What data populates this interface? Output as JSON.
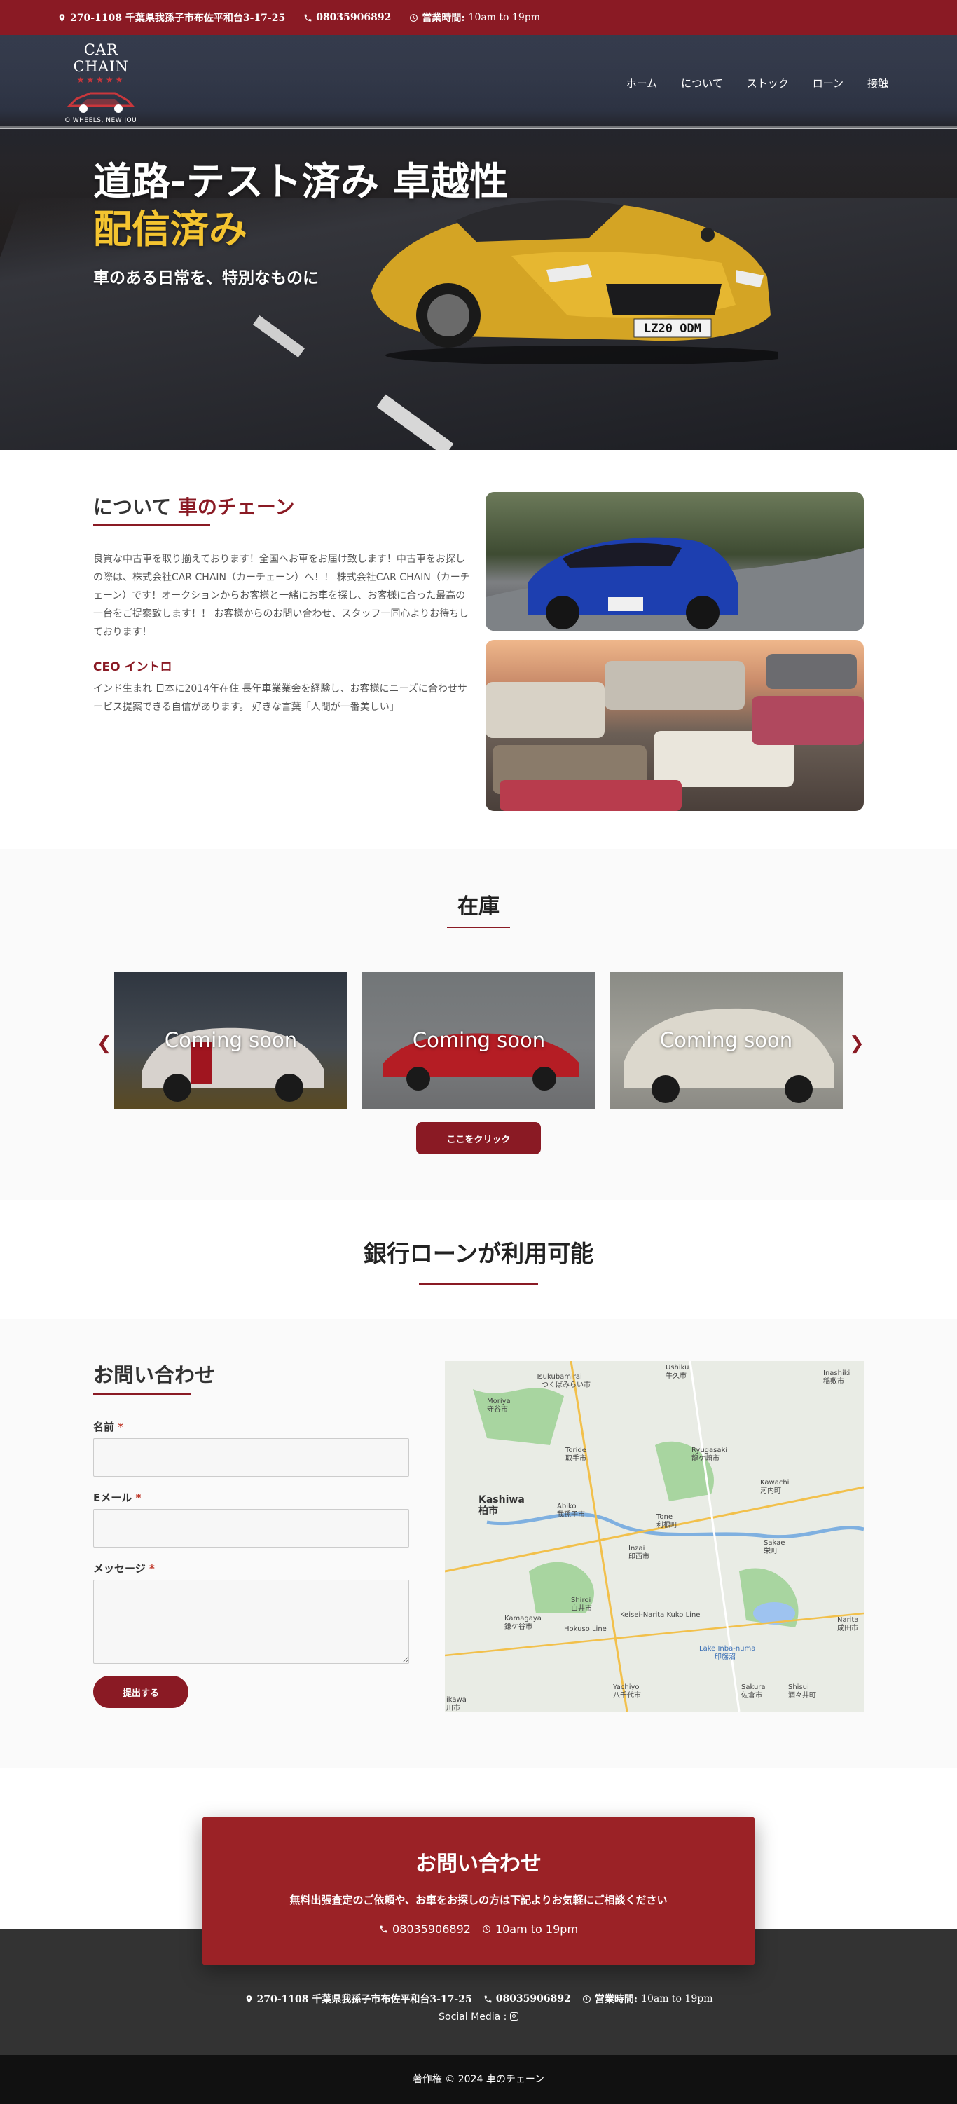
{
  "topbar": {
    "address": "270-1108 千葉県我孫子市布佐平和台3-17-25",
    "phone": "08035906892",
    "hours_label": "営業時間:",
    "hours_value": "10am to 19pm"
  },
  "logo": {
    "title": "CAR CHAIN",
    "stars": "★★★★★",
    "slogan": "O WHEELS, NEW JOU"
  },
  "nav": {
    "items": [
      "ホーム",
      "について",
      "ストック",
      "ローン",
      "接触"
    ]
  },
  "hero": {
    "title_line1": "道路-テスト済み 卓越性",
    "title_line2": "配信済み",
    "subtitle": "車のある日常を、特別なものに",
    "plate": "LZ20 ODM"
  },
  "about": {
    "title_plain": "について",
    "title_accent": "車のチェーン",
    "paragraph": "良質な中古車を取り揃えております！全国へお車をお届け致します！中古車をお探しの際は、株式会社CAR CHAIN（カーチェーン）へ！！ 株式会社CAR CHAIN（カーチェーン）です！オークションからお客様と一緒にお車を探し、お客様に合った最高の一台をご提案致します！！ お客様からのお問い合わせ、スタッフ一同心よりお待ちしております！",
    "ceo_heading": "CEO イントロ",
    "ceo_text": "インド生まれ 日本に2014年在住 長年車業業会を経験し、お客様にニーズに合わせサービス提案できる自信があります。 好きな言葉「人間が一番美しい」"
  },
  "stock": {
    "title": "在庫",
    "cards": [
      "Coming soon",
      "Coming soon",
      "Coming soon"
    ],
    "button": "ここをクリック"
  },
  "loan": {
    "title": "銀行ローンが利用可能"
  },
  "contact": {
    "title": "お問い合わせ",
    "name_label": "名前",
    "email_label": "Eメール",
    "message_label": "メッセージ",
    "required_mark": "*",
    "submit": "提出する",
    "map_labels": [
      "Tsukubamirai",
      "つくばみらい市",
      "Moriya",
      "守谷市",
      "Toride",
      "取手市",
      "Ryugasaki",
      "龍ケ崎市",
      "Kawachi",
      "河内町",
      "Kashiwa",
      "柏市",
      "Abiko",
      "我孫子市",
      "Tone",
      "利根町",
      "Sakae",
      "栄町",
      "Inzai",
      "印西市",
      "Shiroi",
      "白井市",
      "Kamagaya",
      "鎌ケ谷市",
      "Lake Inba-numa",
      "印旛沼",
      "Narita",
      "成田市",
      "Yachiyo",
      "八千代市",
      "Sakura",
      "佐倉市",
      "Shisui",
      "酒々井町",
      "Ushiku",
      "牛久市",
      "Inashiki",
      "稲敷市",
      "Hokuso Line",
      "Keisei-Narita Kuko Line",
      "ikawa",
      "川市"
    ]
  },
  "cta": {
    "title": "お問い合わせ",
    "subtitle": "無料出張査定のご依頼や、お車をお探しの方は下記よりお気軽にご相談ください",
    "phone": "08035906892",
    "hours": "10am to 19pm"
  },
  "footer": {
    "address": "270-1108 千葉県我孫子市布佐平和台3-17-25",
    "phone": "08035906892",
    "hours_label": "営業時間:",
    "hours_value": "10am to 19pm",
    "social_label": "Social Media :",
    "copyright": "著作権 © 2024 車のチェーン"
  },
  "colors": {
    "brand_red": "#8a1a24",
    "cta_red": "#9b2226",
    "hero_yellow": "#f4c430",
    "footer_dark": "#333333"
  }
}
